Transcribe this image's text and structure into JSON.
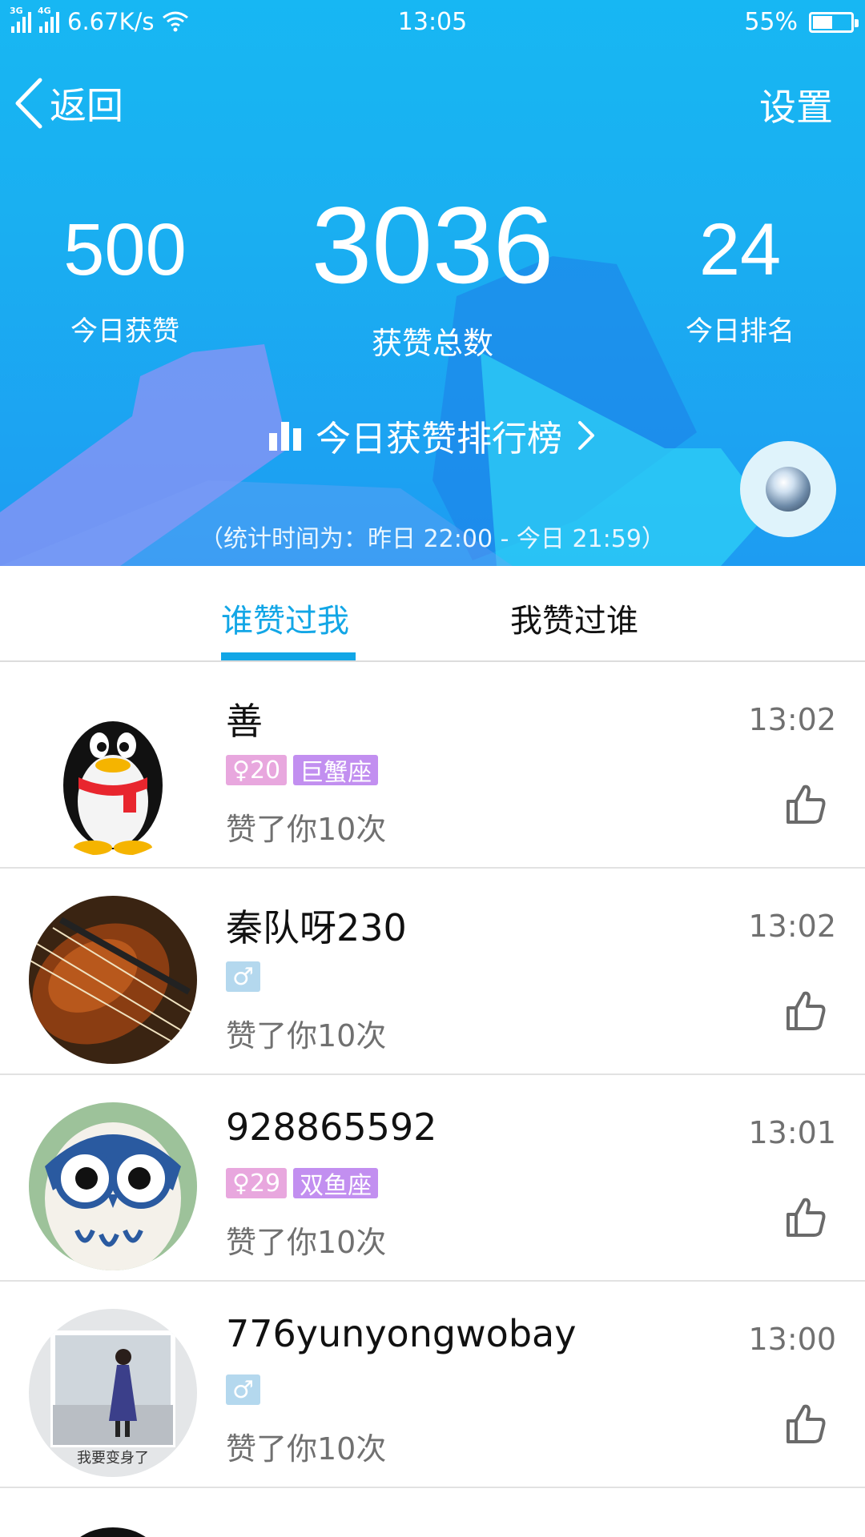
{
  "status_bar": {
    "net1": "3G",
    "net2": "4G",
    "speed": "6.67K/s",
    "time": "13:05",
    "battery": "55%"
  },
  "nav": {
    "back_label": "返回",
    "settings_label": "设置"
  },
  "stats": {
    "today_likes": "500",
    "today_likes_label": "今日获赞",
    "total_likes": "3036",
    "total_likes_label": "获赞总数",
    "today_rank": "24",
    "today_rank_label": "今日排名"
  },
  "rank_link": "今日获赞排行榜",
  "stat_time": "（统计时间为：昨日 22:00 - 今日 21:59）",
  "tabs": [
    {
      "label": "谁赞过我",
      "active": true
    },
    {
      "label": "我赞过谁",
      "active": false
    }
  ],
  "list": [
    {
      "name": "善",
      "time": "13:02",
      "gender_badge": "♀20",
      "zodiac": "巨蟹座",
      "likes": "赞了你10次"
    },
    {
      "name": "秦队呀230",
      "time": "13:02",
      "gender_badge": "♂",
      "zodiac": "",
      "likes": "赞了你10次"
    },
    {
      "name": "928865592",
      "time": "13:01",
      "gender_badge": "♀29",
      "zodiac": "双鱼座",
      "likes": "赞了你10次"
    },
    {
      "name": "776yunyongwobay",
      "time": "13:00",
      "gender_badge": "♂",
      "zodiac": "",
      "likes": "赞了你10次"
    }
  ],
  "colors": {
    "header_blue": "#1aaff1",
    "accent": "#12a6e6",
    "female_badge": "#e8a7de",
    "male_badge": "#b4d8ee",
    "zodiac_badge": "#c28ff0"
  }
}
